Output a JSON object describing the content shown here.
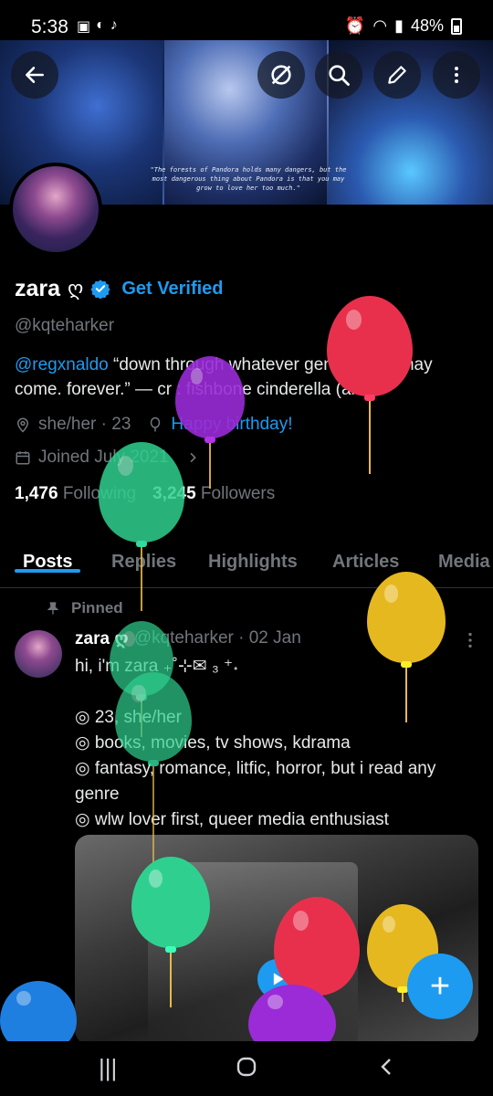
{
  "status_bar": {
    "time": "5:38",
    "battery": "48%"
  },
  "banner": {
    "quote": "\"The forests of Pandora holds many dangers, but the most dangerous thing about Pandora is that you may grow to love her too much.\""
  },
  "header_actions": {
    "back": "back-arrow",
    "grok": "circle-slash",
    "search": "magnifier",
    "edit": "pencil",
    "more": "three-dots"
  },
  "profile": {
    "display_name": "zara",
    "name_symbol": "ღ",
    "get_verified": "Get Verified",
    "handle": "@kqteharker",
    "bio_mention": "@regxnaldo",
    "bio_text": " “down through whatever generations may come. forever.” — cr : fishbone cinderella (arc)",
    "pronouns_age": "she/her · 23",
    "birthday": "Happy birthday!",
    "joined": "Joined July 2021",
    "following_count": "1,476",
    "following_label": "Following",
    "followers_count": "3,245",
    "followers_label": "Followers"
  },
  "tabs": [
    "Posts",
    "Replies",
    "Highlights",
    "Articles",
    "Media"
  ],
  "post": {
    "pinned_label": "Pinned",
    "author": "zara ღ",
    "handle_time": "@kqteharker · 02 Jan",
    "body": "hi, i'm zara ₊˚⊹✉︎ ₃ ⁺˖\n\n◎ 23, she/her\n◎ books, movies, tv shows, kdrama\n◎ fantasy, romance, litfic, horror, but i read any genre\n◎ wlw lover first, queer media enthusiast"
  },
  "fab_label": "+",
  "colors": {
    "accent": "#1d9bf0",
    "balloon_red": "#e8304d",
    "balloon_purple": "#9a2bd6",
    "balloon_green": "#2fd08f",
    "balloon_yellow": "#e6b820",
    "balloon_blue": "#1f7fe0"
  }
}
